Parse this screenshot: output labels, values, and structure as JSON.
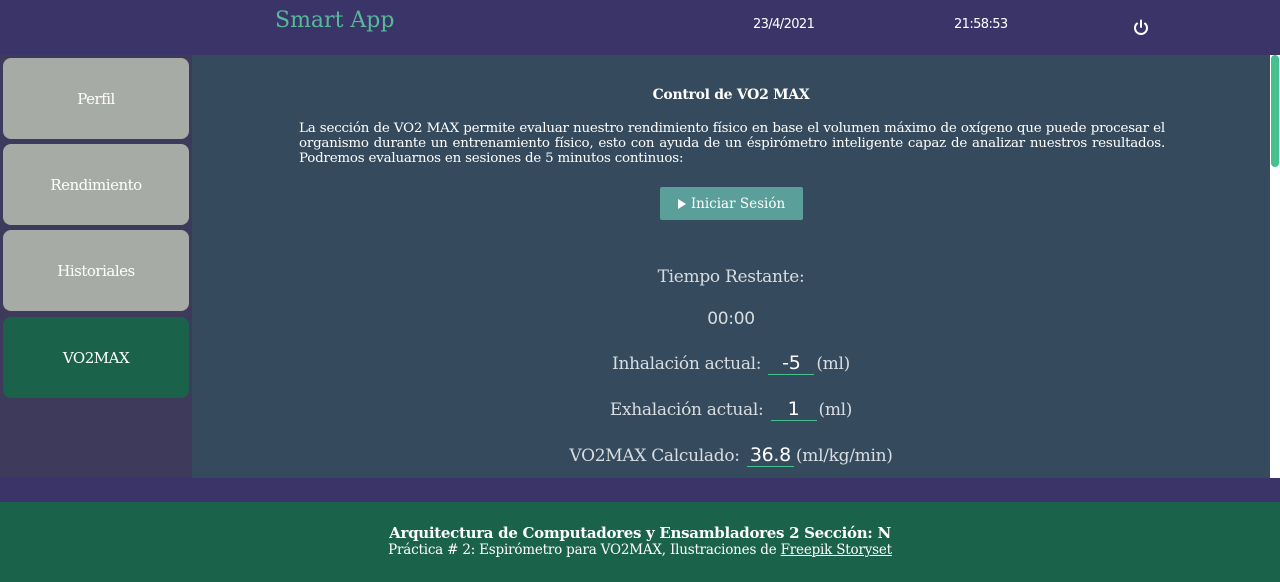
{
  "header": {
    "app_title": "Smart App",
    "date": "23/4/2021",
    "time": "21:58:53",
    "power_icon": "power-icon"
  },
  "sidebar": {
    "items": [
      {
        "label": "Perfil",
        "active": false
      },
      {
        "label": "Rendimiento",
        "active": false
      },
      {
        "label": "Historiales",
        "active": false
      },
      {
        "label": "VO2MAX",
        "active": true
      }
    ]
  },
  "main": {
    "title": "Control de VO2 MAX",
    "description": "La sección de VO2 MAX permite evaluar nuestro rendimiento físico en base el volumen máximo de oxígeno que puede procesar el organismo durante un entrenamiento físico, esto con ayuda de un éspirómetro inteligente capaz de analizar nuestros resultados. Podremos evaluarnos en sesiones de 5 minutos continuos:",
    "start_button": "Iniciar Sesión",
    "time_label": "Tiempo Restante:",
    "time_value": "00:00",
    "inhalation_label": "Inhalación actual:",
    "inhalation_value": "-5",
    "inhalation_unit": "(ml)",
    "exhalation_label": "Exhalación actual:",
    "exhalation_value": "1",
    "exhalation_unit": "(ml)",
    "vo2_label": "VO2MAX Calculado:",
    "vo2_value": "36.8",
    "vo2_unit": "(ml/kg/min)"
  },
  "footer": {
    "title": "Arquitectura de Computadores y Ensambladores 2 Sección: N",
    "subtitle_prefix": "Práctica # 2: Espirómetro para VO2MAX, Ilustraciones de ",
    "link_text": "Freepik Storyset"
  },
  "colors": {
    "header_bg": "#3b3468",
    "accent_green": "#57b89a",
    "active_nav": "#1a6249",
    "inactive_nav": "#a7aba5",
    "main_bg": "#354a5c",
    "button_bg": "#5a9f9a"
  }
}
